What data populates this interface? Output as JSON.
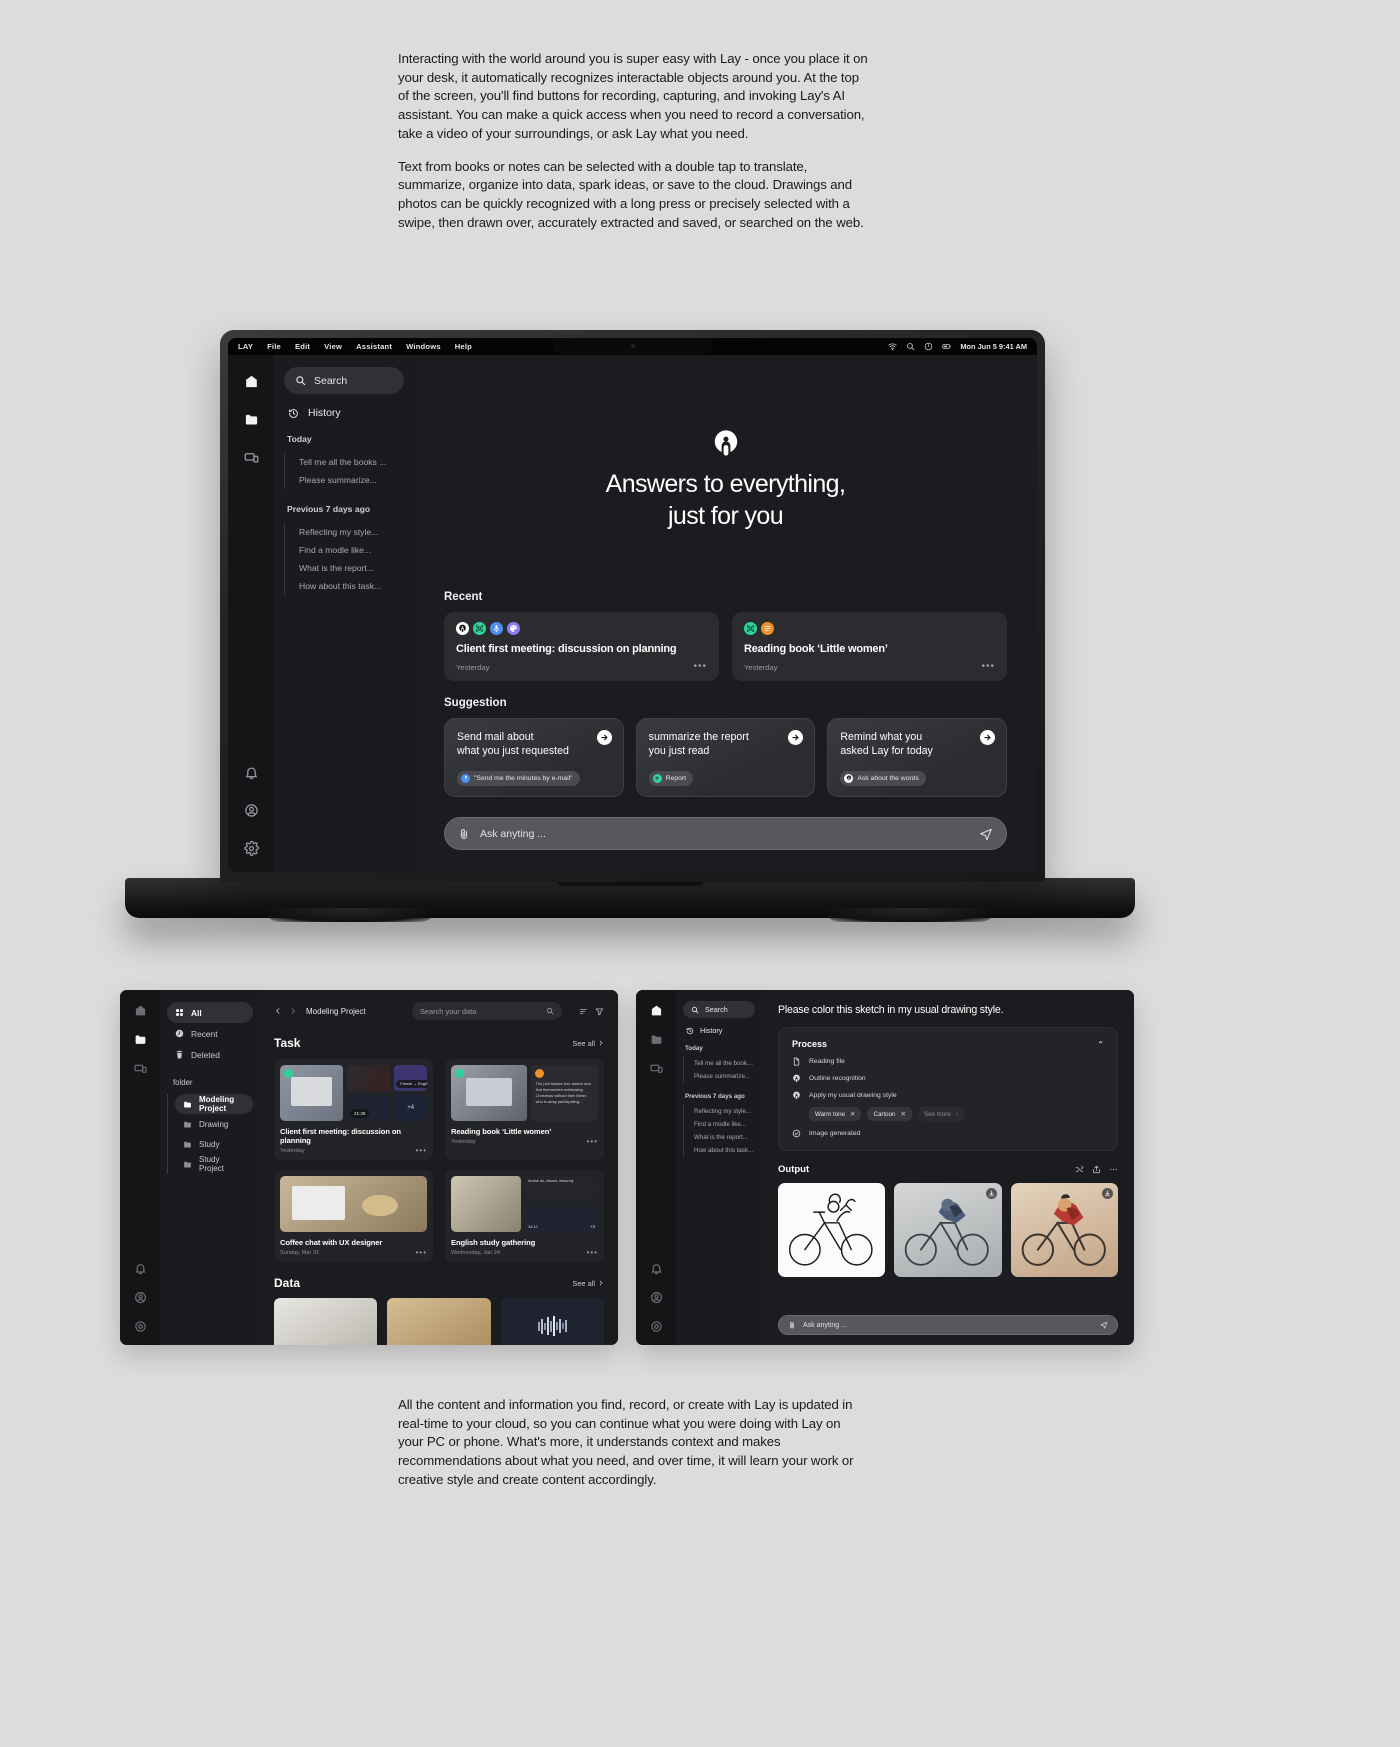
{
  "copy": {
    "top_paragraph_1": "Interacting with the world around you is super easy with Lay - once you place it on your desk, it automatically recognizes interactable objects around you. At the top of the screen, you'll find buttons for recording, capturing, and invoking Lay's AI assistant. You can make a quick access when you need to record a conversation, take a video of your surroundings, or ask Lay what you need.",
    "top_paragraph_2": "Text from books or notes can be selected with a double tap to translate, summarize, organize into data, spark ideas, or save to the cloud. Drawings and photos can be quickly recognized with a long press or precisely selected with a swipe, then drawn over, accurately extracted and saved, or searched on the web.",
    "bottom_paragraph_1": "All the content and information you find, record, or create with Lay is updated in real-time to your cloud, so you can continue what you were doing with Lay on your PC or phone. What's more, it understands context and makes recommendations about what you need, and over time, it will learn your work or creative style and create content accordingly."
  },
  "menubar": {
    "brand": "LAY",
    "items": [
      "File",
      "Edit",
      "View",
      "Assistant",
      "Windows",
      "Help"
    ],
    "status_icons": [
      "wifi-icon",
      "search-icon",
      "control-center-icon",
      "battery-icon"
    ],
    "datetime": "Mon Jun 5  9:41 AM"
  },
  "rail": {
    "top_items": [
      {
        "name": "home-icon",
        "label": "Home"
      },
      {
        "name": "folder-icon",
        "label": "Files"
      },
      {
        "name": "devices-icon",
        "label": "Devices"
      }
    ],
    "bottom_items": [
      {
        "name": "bell-icon",
        "label": "Notifications"
      },
      {
        "name": "account-icon",
        "label": "Account"
      },
      {
        "name": "gear-icon",
        "label": "Settings"
      }
    ]
  },
  "sidebar": {
    "search_placeholder": "Search",
    "history_label": "History",
    "groups": [
      {
        "label": "Today",
        "items": [
          "Tell me all the books ...",
          "Please summarize..."
        ]
      },
      {
        "label": "Previous 7 days ago",
        "items": [
          "Reflecting my style...",
          "Find a modle like...",
          "What is the report...",
          "How about this task..."
        ]
      }
    ]
  },
  "hero": {
    "logo": "lay-logo-icon",
    "title_line_1": "Answers to everything,",
    "title_line_2": "just for you"
  },
  "recent": {
    "title": "Recent",
    "cards": [
      {
        "title": "Client first meeting: discussion on planning",
        "time": "Yesterday",
        "avatars": [
          "lay-logo-icon",
          "scan-icon",
          "mic-icon",
          "palette-icon"
        ],
        "avatar_colors": [
          "#ffffff",
          "#2fd39a",
          "#4c8ef7",
          "#8b7cf6"
        ],
        "more": "•••"
      },
      {
        "title": "Reading book ‘Little women’",
        "time": "Yesterday",
        "avatars": [
          "scan-icon",
          "text-icon"
        ],
        "avatar_colors": [
          "#2fd39a",
          "#f0922c"
        ],
        "more": "•••"
      }
    ]
  },
  "suggestion": {
    "title": "Suggestion",
    "cards": [
      {
        "question": "Send mail about\nwhat you just requested",
        "chip": "\"Send me the minutes by e-mail\"",
        "chip_icon": "mic-icon",
        "chip_color": "#4c8ef7",
        "arrow": "arrow-right-icon"
      },
      {
        "question": "summarize the report\nyou just read",
        "chip": "Report",
        "chip_icon": "scan-icon",
        "chip_color": "#2fd39a",
        "arrow": "arrow-right-icon"
      },
      {
        "question": "Remind what you\nasked Lay for today",
        "chip": "Ask about the words",
        "chip_icon": "lay-logo-icon",
        "chip_color": "#ffffff",
        "arrow": "arrow-right-icon"
      }
    ]
  },
  "askbar": {
    "placeholder": "Ask anyting ...",
    "attach_icon": "paperclip-icon",
    "send_icon": "send-icon"
  },
  "files_panel": {
    "sidebar": {
      "items": [
        {
          "label": "All",
          "icon": "grid-icon",
          "active": true
        },
        {
          "label": "Recent",
          "icon": "clock-icon",
          "active": false
        },
        {
          "label": "Deleted",
          "icon": "trash-icon",
          "active": false
        }
      ],
      "folder_label": "folder",
      "folders": [
        {
          "label": "Modeling Project",
          "active": true
        },
        {
          "label": "Drawing",
          "active": false
        },
        {
          "label": "Study",
          "active": false
        },
        {
          "label": "Study Project",
          "active": false
        }
      ]
    },
    "breadcrumb": "Modeling Project",
    "search_placeholder": "Search your data",
    "nav_back": "chevron-left-icon",
    "nav_forward": "chevron-right-icon",
    "tools": [
      "sort-icon",
      "filter-icon"
    ],
    "sections": [
      {
        "title": "Task",
        "see_all": "See all",
        "cards": [
          {
            "caption": "Client first meeting: discussion on planning",
            "date": "Yesterday",
            "chips": [
              "French → English",
              "21:39",
              "+4"
            ]
          },
          {
            "caption": "Reading book ‘Little women’",
            "date": "Yesterday",
            "chips": [
              "The plot follows four sisters who find themselves celebrating Christmas without their father, who is away participating..."
            ]
          },
          {
            "caption": "Coffee chat with UX designer",
            "date": "Sunday, Mar 31",
            "chips": []
          },
          {
            "caption": "English study gathering",
            "date": "Wednesday, Jan 24",
            "chips": [
              "incline do, leisure, leisurely",
              "34:12",
              "+3"
            ]
          }
        ]
      },
      {
        "title": "Data",
        "see_all": "See all",
        "cards": []
      }
    ]
  },
  "chat_panel": {
    "sidebar": {
      "search_placeholder": "Search",
      "history_label": "History",
      "groups": [
        {
          "label": "Today",
          "items": [
            "Tell me all the books ...",
            "Please summarize..."
          ]
        },
        {
          "label": "Previous 7 days ago",
          "items": [
            "Reflecting my style...",
            "Find a modle like...",
            "What is the report...",
            "How about this task..."
          ]
        }
      ]
    },
    "prompt": "Please color this sketch in my usual drawing style.",
    "process": {
      "title": "Process",
      "collapse_icon": "chevron-up-icon",
      "steps": [
        {
          "label": "Reading file",
          "icon": "file-icon"
        },
        {
          "label": "Outline recognition",
          "icon": "lay-logo-icon"
        },
        {
          "label": "Apply my usual drawing style",
          "icon": "lay-logo-icon"
        },
        {
          "label": "Image generated",
          "icon": "check-circle-icon"
        }
      ],
      "style_chips": [
        {
          "label": "Warm tone",
          "removable": true
        },
        {
          "label": "Cartoon",
          "removable": true
        }
      ],
      "see_more": "See more"
    },
    "output": {
      "title": "Output",
      "tools": [
        "shuffle-icon",
        "share-icon",
        "more-icon"
      ],
      "images": [
        {
          "name": "bicycle-sketch-line-art",
          "download": false,
          "bg": "#ffffff"
        },
        {
          "name": "bicycle-grey-render",
          "download": true,
          "bg": "#bfc2c4"
        },
        {
          "name": "bicycle-warm-cartoon",
          "download": true,
          "bg": "#d8c4ae"
        }
      ]
    },
    "askbar": {
      "placeholder": "Ask anyting ...",
      "attach_icon": "paperclip-icon",
      "send_icon": "send-icon"
    }
  }
}
